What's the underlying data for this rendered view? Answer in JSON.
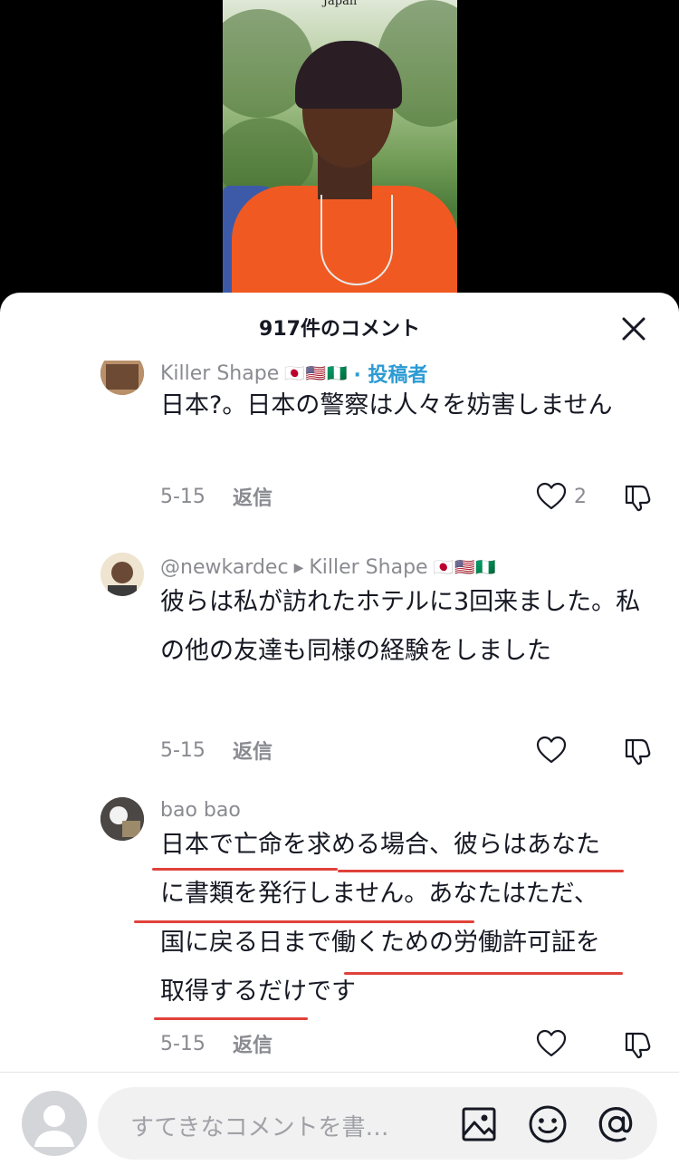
{
  "video": {
    "caption": "Japan"
  },
  "sheet": {
    "title": "917件のコメント"
  },
  "comments": [
    {
      "user": "Killer Shape",
      "flags": "🇯🇵🇺🇸🇳🇬",
      "author_badge": "· 投稿者",
      "text": "日本?。日本の警察は人々を妨害しません",
      "date": "5-15",
      "reply_label": "返信",
      "likes": "2"
    },
    {
      "user": "@newkardec",
      "reply_to": "Killer Shape",
      "reply_to_flags": "🇯🇵🇺🇸🇳🇬",
      "text": "彼らは私が訪れたホテルに3回来ました。私の他の友達も同様の経験をしました",
      "date": "5-15",
      "reply_label": "返信",
      "likes": ""
    },
    {
      "user": "bao bao",
      "lines": [
        "日本で亡命を求める場合、彼らはあなた",
        "に書類を発行しません。あなたはただ、",
        "国に戻る日まで働くための労働許可証を",
        "取得するだけです"
      ],
      "date": "5-15",
      "reply_label": "返信",
      "likes": ""
    }
  ],
  "input": {
    "placeholder": "すてきなコメントを書…"
  },
  "colors": {
    "accent": "#2d9bd3",
    "annotation": "#e0413b",
    "text": "#161823",
    "muted": "#8a8b91"
  }
}
